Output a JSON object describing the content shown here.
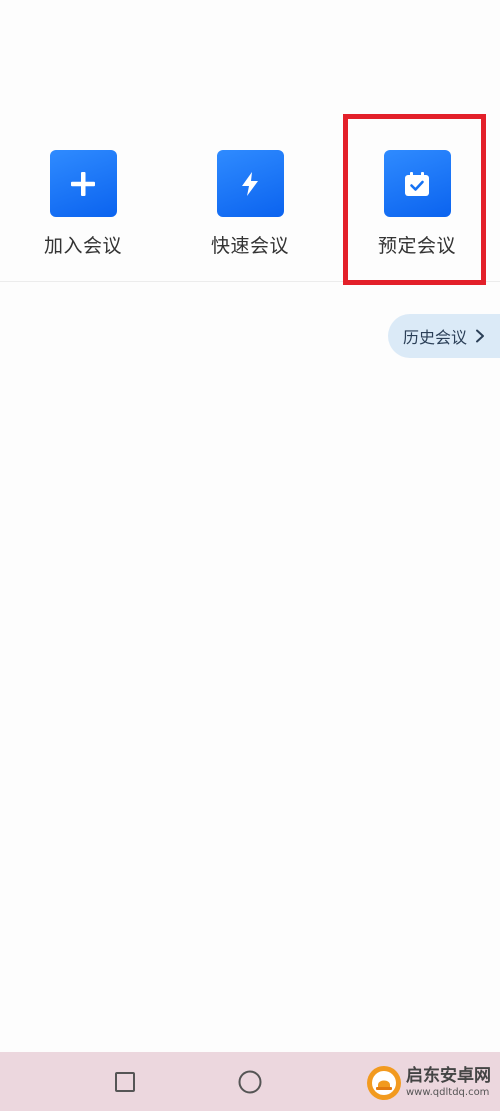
{
  "actions": {
    "join": {
      "label": "加入会议",
      "icon": "plus-icon"
    },
    "quick": {
      "label": "快速会议",
      "icon": "lightning-icon"
    },
    "schedule": {
      "label": "预定会议",
      "icon": "calendar-check-icon"
    }
  },
  "history": {
    "label": "历史会议",
    "icon": "chevron-right-icon"
  },
  "navbar": {
    "recent_icon": "square-icon",
    "home_icon": "circle-icon"
  },
  "watermark": {
    "title": "启东安卓网",
    "url": "www.qdltdq.com"
  },
  "colors": {
    "accent": "#1672f3",
    "highlight": "#e3202a",
    "history_bg": "#dbeaf7",
    "navbar_bg": "#ecd7de"
  }
}
